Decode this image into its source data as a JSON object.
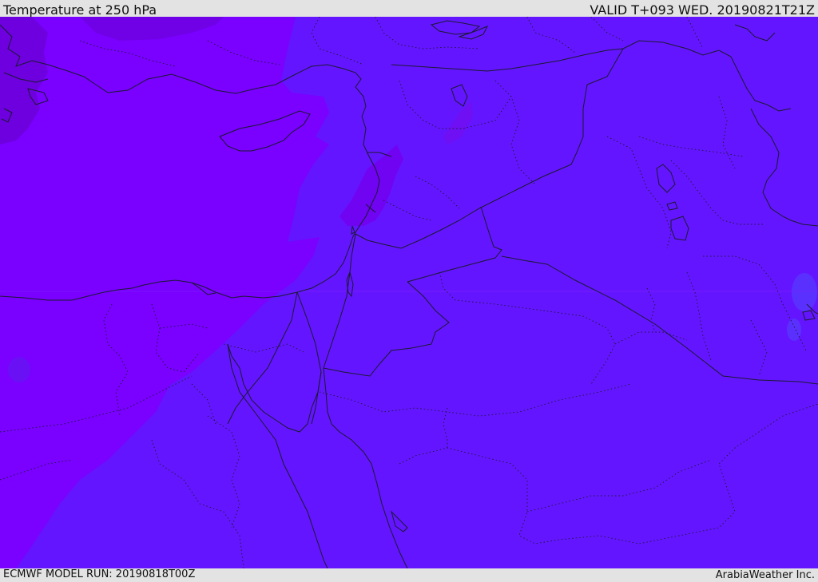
{
  "header": {
    "title": "Temperature at 250 hPa",
    "valid_time": "VALID T+093 WED. 20190821T21Z"
  },
  "footer": {
    "model_run": "ECMWF MODEL RUN: 20190818T00Z",
    "credit": "ArabiaWeather Inc."
  },
  "colors": {
    "warm_band": "#7a00ff",
    "cool_band": "#6415ff",
    "darker_band": "#7000e6",
    "coast": "#1a1a2e",
    "border": "#1a1a2e"
  }
}
